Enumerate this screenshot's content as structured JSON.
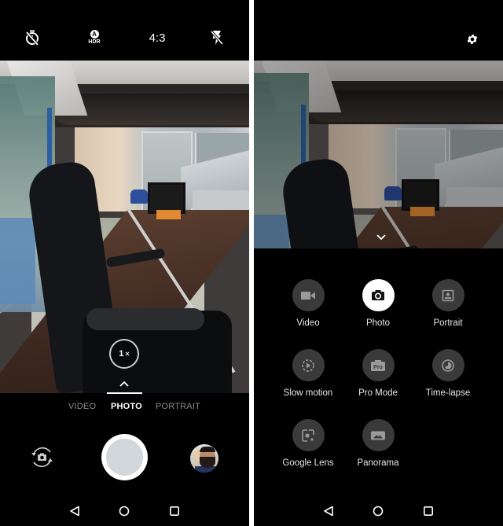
{
  "left_screen": {
    "top_bar": {
      "timer": {
        "icon": "timer-off-icon"
      },
      "hdr": {
        "icon": "hdr-auto-icon",
        "badge": "A",
        "label": "HDR"
      },
      "aspect_ratio": "4:3",
      "flash": {
        "icon": "flash-off-icon"
      }
    },
    "zoom": {
      "value": "1",
      "suffix": "×"
    },
    "modes": [
      {
        "label": "VIDEO",
        "selected": false
      },
      {
        "label": "PHOTO",
        "selected": true
      },
      {
        "label": "PORTRAIT",
        "selected": false
      }
    ],
    "controls": {
      "switch_camera": "switch-camera-icon",
      "shutter": "shutter-button",
      "gallery": "gallery-thumbnail"
    }
  },
  "right_screen": {
    "top_bar": {
      "settings": "gear-icon"
    },
    "mode_menu": [
      {
        "label": "Video",
        "icon": "video-camera-icon",
        "selected": false
      },
      {
        "label": "Photo",
        "icon": "camera-icon",
        "selected": true
      },
      {
        "label": "Portrait",
        "icon": "portrait-icon",
        "selected": false
      },
      {
        "label": "Slow motion",
        "icon": "slow-motion-icon",
        "selected": false
      },
      {
        "label": "Pro Mode",
        "icon": "pro-mode-icon",
        "badge": "Pro",
        "selected": false
      },
      {
        "label": "Time-lapse",
        "icon": "time-lapse-icon",
        "selected": false
      },
      {
        "label": "Google Lens",
        "icon": "google-lens-icon",
        "selected": false
      },
      {
        "label": "Panorama",
        "icon": "panorama-icon",
        "selected": false
      }
    ]
  },
  "nav_bar": {
    "back": "back-icon",
    "home": "home-icon",
    "recents": "recents-icon"
  },
  "colors": {
    "background": "#000000",
    "text_primary": "#ffffff",
    "text_inactive": "#8a8a8a",
    "mode_circle": "#3a3a3a",
    "shutter_inner": "#d2d7dc"
  }
}
